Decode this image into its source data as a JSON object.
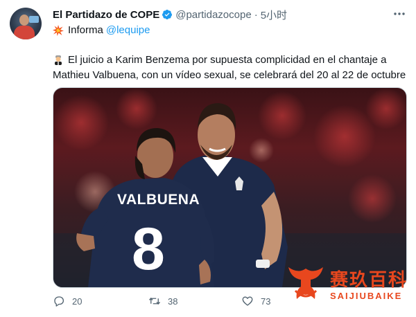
{
  "account": {
    "display_name": "El Partidazo de COPE",
    "handle": "@partidazocope",
    "separator": "·",
    "time": "5小时"
  },
  "subheader": {
    "icon": "collision-icon",
    "label": "Informa",
    "mention": "@lequipe"
  },
  "tweet": {
    "emoji": "judge-emoji",
    "text": "El juicio a Karim Benzema por supuesta complicidad en el chantaje a Mathieu Valbuena, con un vídeo sexual, se celebrará del 20 al 22 de octubre"
  },
  "media": {
    "jersey_name": "VALBUENA",
    "jersey_number": "8"
  },
  "actions": {
    "reply_count": "20",
    "retweet_count": "38",
    "like_count": "73"
  },
  "watermark": {
    "chinese": "赛玖百科",
    "english": "SAIJIUBAIKE"
  },
  "colors": {
    "accent": "#1d9bf0",
    "muted": "#536471",
    "watermark": "#e8471e"
  }
}
